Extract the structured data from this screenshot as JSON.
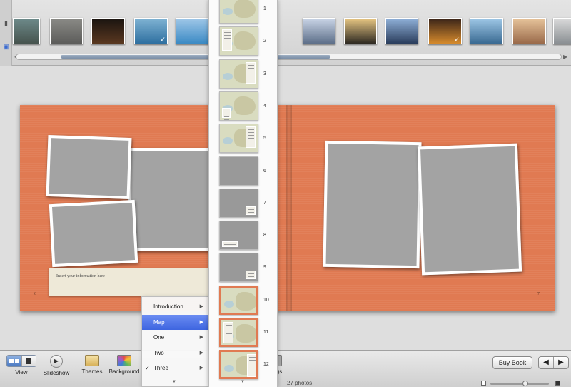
{
  "photo_strip": {
    "thumbs": [
      {
        "id": "t1",
        "colors": [
          "#6d8a8a",
          "#46534e"
        ],
        "checked": false
      },
      {
        "id": "t2",
        "colors": [
          "#8a8a86",
          "#5c5c5a"
        ],
        "checked": false
      },
      {
        "id": "t3",
        "colors": [
          "#1a1410",
          "#5a3820"
        ],
        "checked": false
      },
      {
        "id": "t4",
        "colors": [
          "#7fb3d3",
          "#2e6fa0"
        ],
        "checked": true
      },
      {
        "id": "t5",
        "colors": [
          "#9fc7e8",
          "#3b8ac4"
        ],
        "checked": false
      },
      {
        "id": "t6",
        "colors": [
          "#6a85a4",
          "#2c4a6a"
        ],
        "checked": false
      },
      {
        "id": "t7",
        "colors": [
          "#c9d4e6",
          "#5d6f89"
        ],
        "checked": false
      },
      {
        "id": "t8",
        "colors": [
          "#e7c682",
          "#2e2a22"
        ],
        "checked": false
      },
      {
        "id": "t9",
        "colors": [
          "#8fb0d8",
          "#2a3d5c"
        ],
        "checked": false
      },
      {
        "id": "t10",
        "colors": [
          "#3a2418",
          "#d58a2c"
        ],
        "checked": true
      },
      {
        "id": "t11",
        "colors": [
          "#9ec7e6",
          "#3a6a92"
        ],
        "checked": false
      },
      {
        "id": "t12",
        "colors": [
          "#e6c39a",
          "#9a6a4a"
        ],
        "checked": false
      },
      {
        "id": "t13",
        "colors": [
          "#dadada",
          "#8a8f93"
        ],
        "checked": false
      }
    ]
  },
  "book": {
    "left_paper_text": "Insert your information here",
    "left_page_number": "6",
    "right_page_number": "7",
    "page_color": "#e07a52"
  },
  "toolbar": {
    "view_label": "View",
    "slideshow_label": "Slideshow",
    "themes_label": "Themes",
    "background_label": "Background",
    "settings_partial_label": "gs",
    "buy_book_label": "Buy Book",
    "prev_icon": "◀",
    "next_icon": "▶",
    "photo_count": "27 photos"
  },
  "menu": {
    "items": [
      {
        "label": "Introduction",
        "selected": false,
        "checked": false
      },
      {
        "label": "Map",
        "selected": true,
        "checked": false
      },
      {
        "label": "One",
        "selected": false,
        "checked": false
      },
      {
        "label": "Two",
        "selected": false,
        "checked": false
      },
      {
        "label": "Three",
        "selected": false,
        "checked": true
      }
    ],
    "arrow_glyph": "▶",
    "check_glyph": "✓",
    "scroll_glyph": "▼"
  },
  "layouts": {
    "numbers": [
      "1",
      "2",
      "3",
      "4",
      "5",
      "6",
      "7",
      "8",
      "9",
      "10",
      "11",
      "12"
    ],
    "scroll_glyph": "▼"
  },
  "colors": {
    "accent": "#3e65e0",
    "page": "#e07a52"
  }
}
